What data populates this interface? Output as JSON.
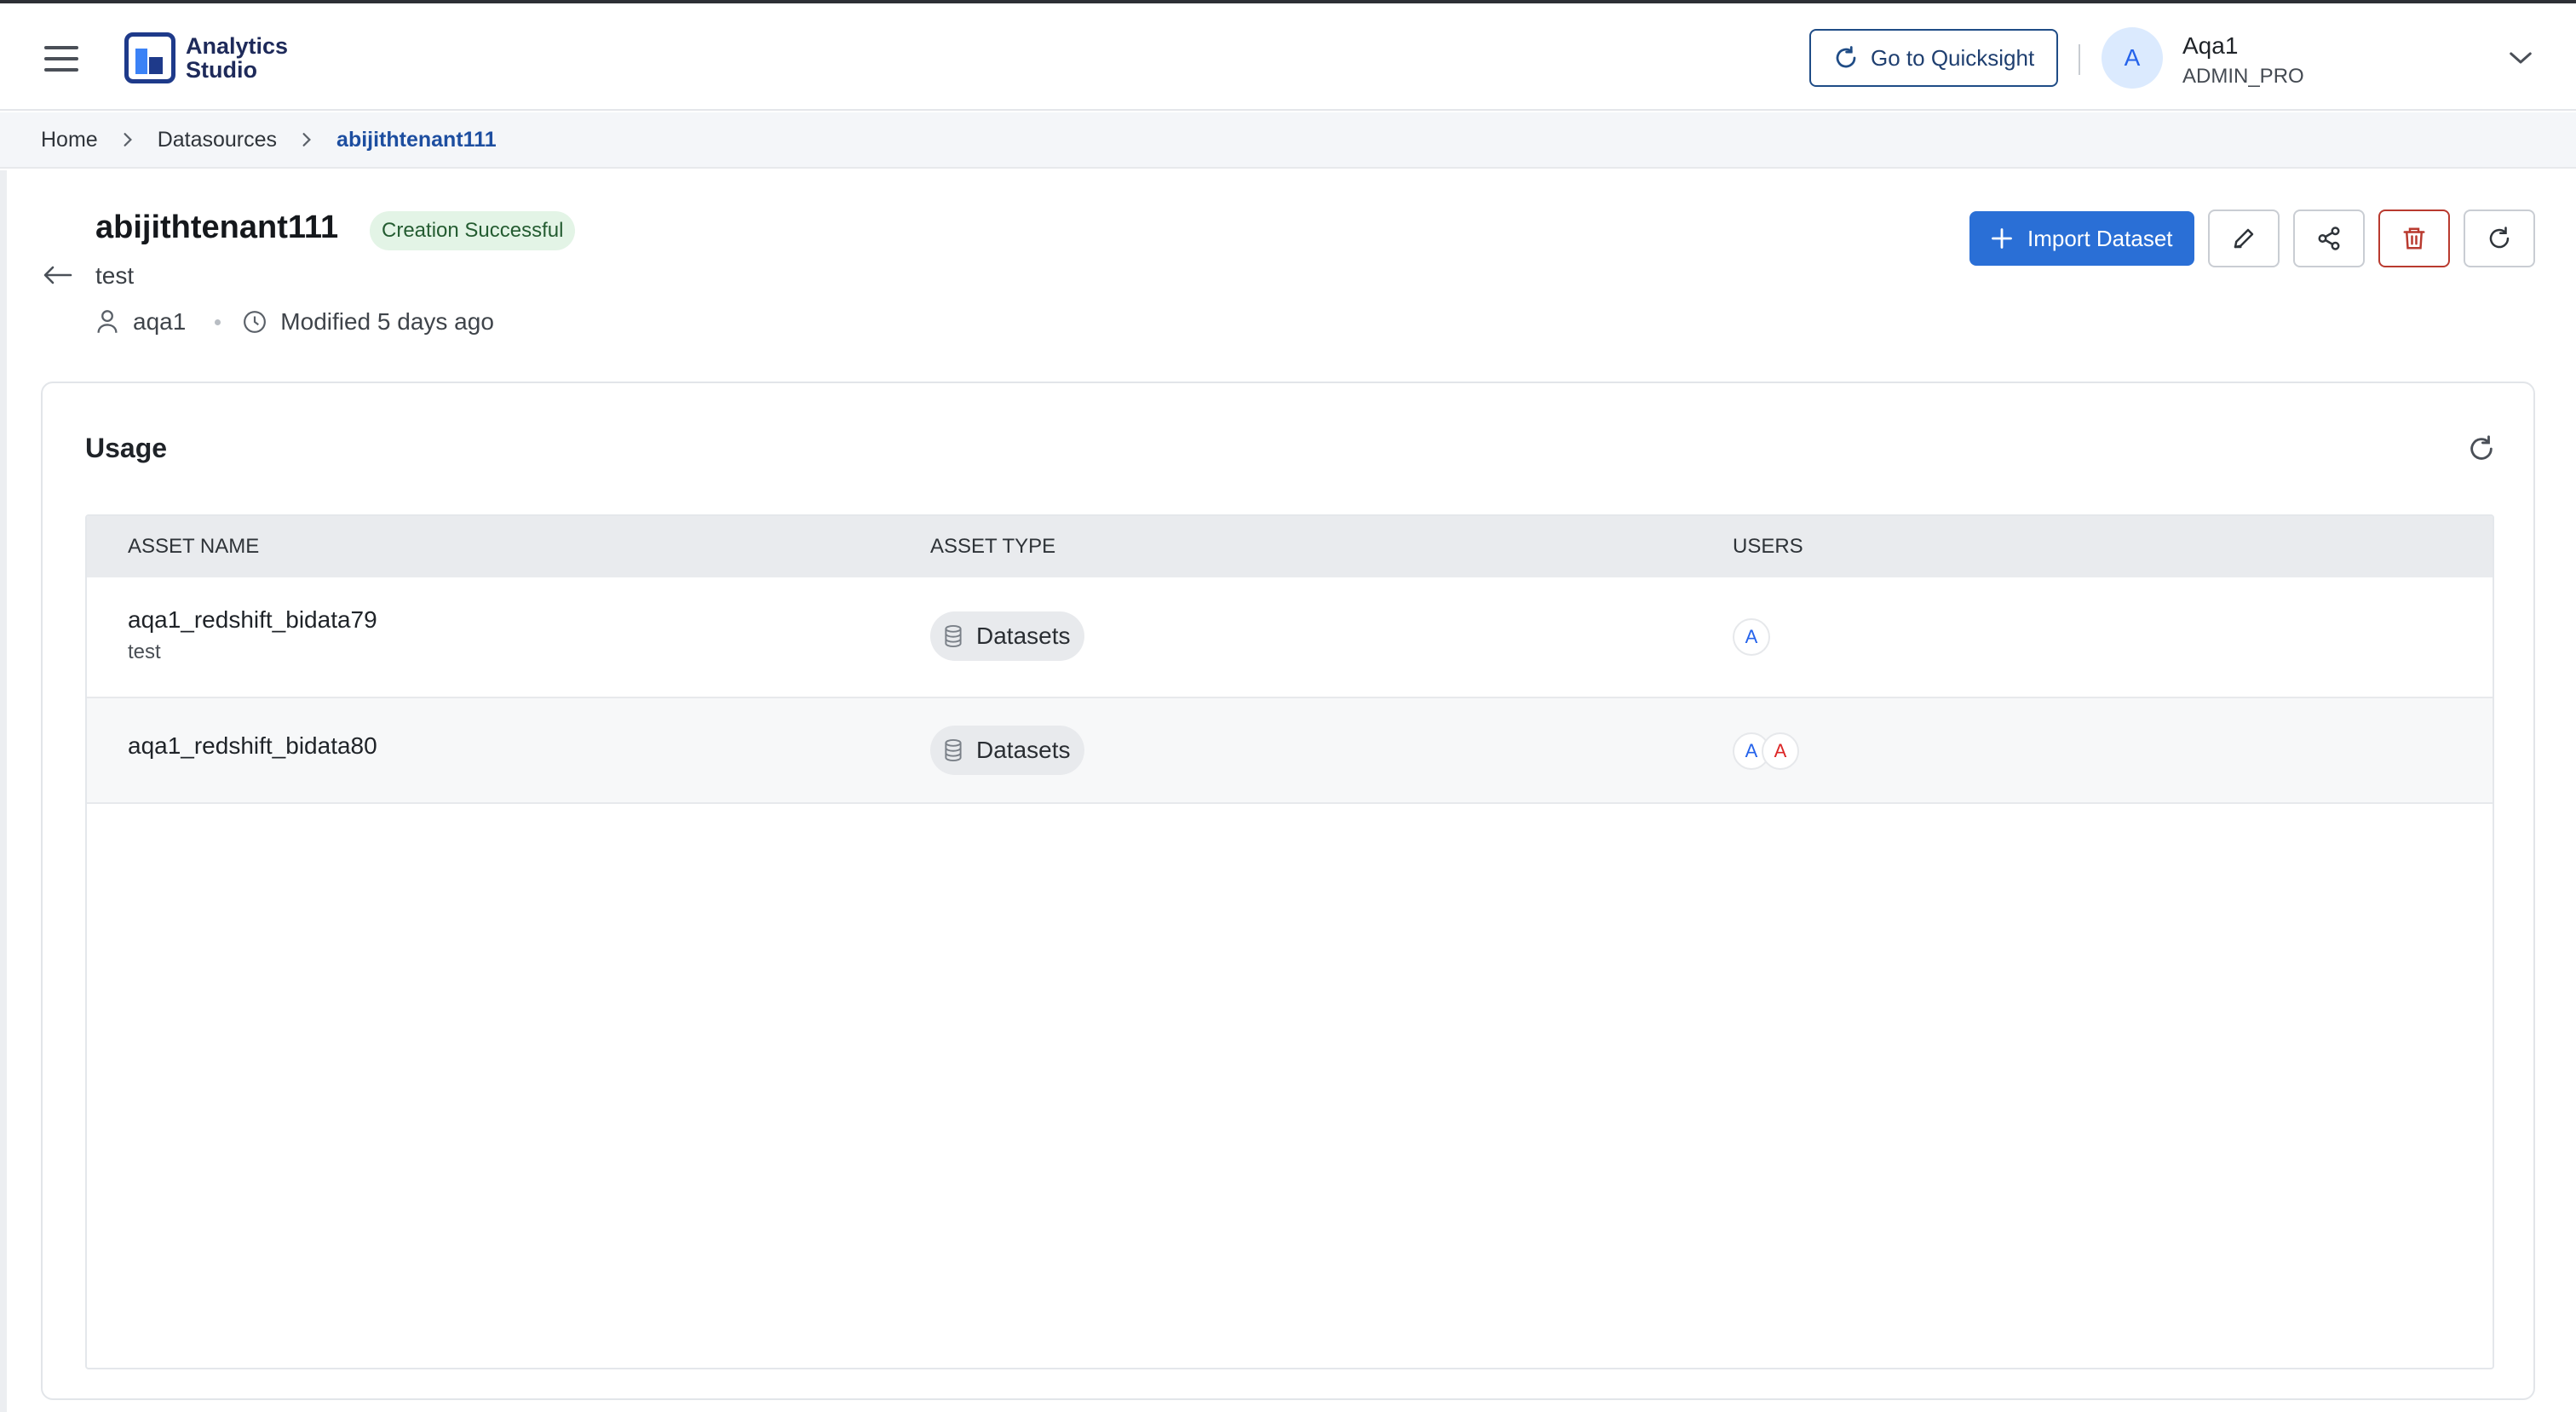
{
  "app": {
    "name": "Analytics Studio"
  },
  "header": {
    "quicksight_label": "Go to Quicksight",
    "user": {
      "initial": "A",
      "name": "Aqa1",
      "role": "ADMIN_PRO"
    }
  },
  "breadcrumb": [
    "Home",
    "Datasources",
    "abijithtenant111"
  ],
  "datasource": {
    "title": "abijithtenant111",
    "status": "Creation Successful",
    "description": "test",
    "owner": "aqa1",
    "modified": "Modified 5 days ago"
  },
  "actions": {
    "import_label": "Import Dataset"
  },
  "usage": {
    "title": "Usage",
    "columns": [
      "ASSET NAME",
      "ASSET TYPE",
      "USERS"
    ],
    "rows": [
      {
        "name": "aqa1_redshift_bidata79",
        "description": "test",
        "type": "Datasets",
        "users": [
          "A"
        ]
      },
      {
        "name": "aqa1_redshift_bidata80",
        "description": "",
        "type": "Datasets",
        "users": [
          "A",
          "A"
        ]
      }
    ]
  },
  "colors": {
    "primary": "#2a6fd6",
    "success_bg": "#e3f4e6",
    "success_text": "#245c31",
    "danger": "#b93a2f",
    "user_blue": "#2563eb",
    "user_red": "#dc2626"
  }
}
